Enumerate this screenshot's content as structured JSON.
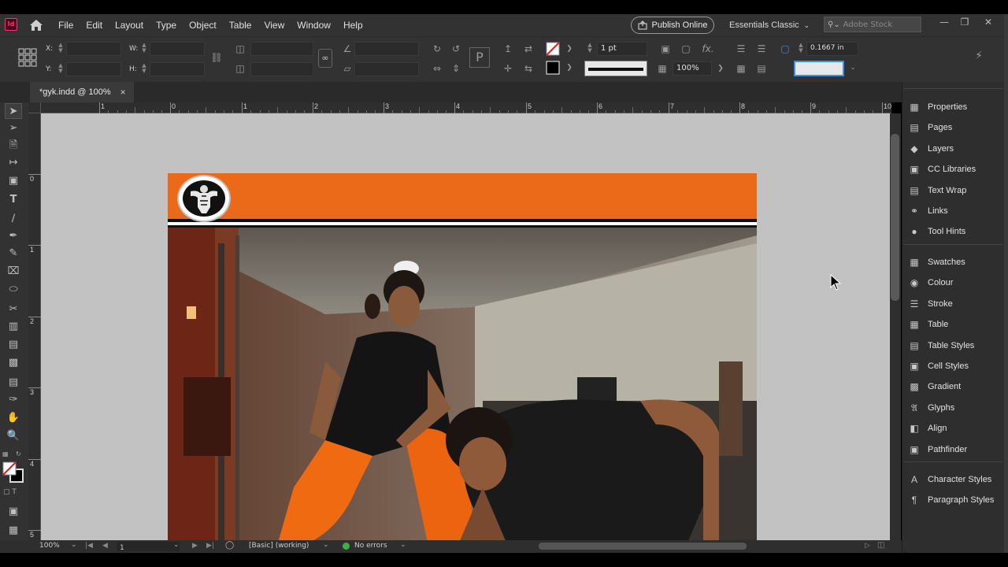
{
  "app": {
    "icon_label": "Id"
  },
  "menu": [
    "File",
    "Edit",
    "Layout",
    "Type",
    "Object",
    "Table",
    "View",
    "Window",
    "Help"
  ],
  "header": {
    "publish_label": "Publish Online",
    "workspace_label": "Essentials Classic",
    "stock_placeholder": "Adobe Stock"
  },
  "control": {
    "x_label": "X:",
    "y_label": "Y:",
    "w_label": "W:",
    "h_label": "H:",
    "stroke_weight": "1 pt",
    "scale": "100%",
    "offset_value": "0.1667 in"
  },
  "document": {
    "tab_label": "*gyk.indd @ 100%",
    "close_symbol": "×"
  },
  "rulers": {
    "horizontal": [
      "1",
      "0",
      "1",
      "2",
      "3",
      "4",
      "5",
      "6",
      "7",
      "8",
      "9",
      "10"
    ],
    "vertical": [
      "0",
      "1",
      "2",
      "3",
      "4",
      "5"
    ]
  },
  "status": {
    "zoom": "100%",
    "page": "1",
    "style": "[Basic] (working)",
    "errors": "No errors"
  },
  "panels": {
    "group1": [
      "Properties",
      "Pages",
      "Layers",
      "CC Libraries",
      "Text Wrap",
      "Links",
      "Tool Hints"
    ],
    "group2": [
      "Swatches",
      "Colour",
      "Stroke",
      "Table",
      "Table Styles",
      "Cell Styles",
      "Gradient",
      "Glyphs",
      "Align",
      "Pathfinder"
    ],
    "group3": [
      "Character Styles",
      "Paragraph Styles"
    ]
  },
  "colors": {
    "header_orange": "#ea6a19",
    "pasteboard": "#c2c2c2",
    "ui_dark": "#323232",
    "status_ok": "#3fae49"
  }
}
